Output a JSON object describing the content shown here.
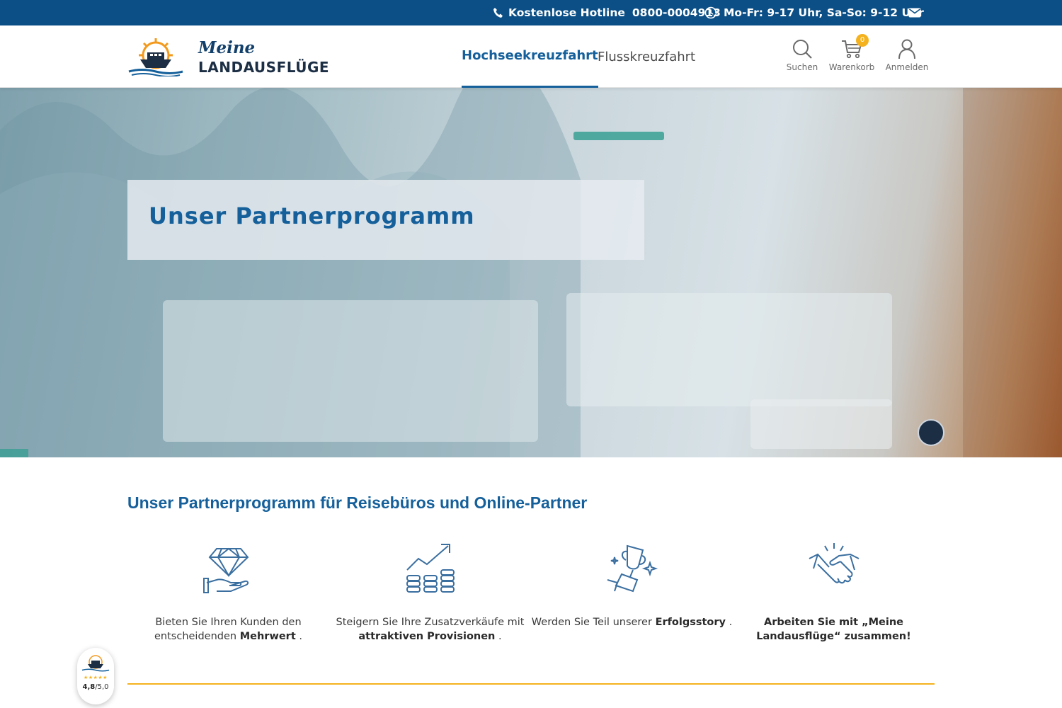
{
  "topbar": {
    "hotline_label": "Kostenlose Hotline",
    "hotline_number": "0800-0004913",
    "hours": "Mo-Fr: 9-17 Uhr, Sa-So: 9-12 Uhr"
  },
  "logo": {
    "line1": "Meine",
    "line2": "LANDAUSFLÜGE"
  },
  "nav": {
    "items": [
      {
        "label": "Hochseekreuzfahrt",
        "active": true
      },
      {
        "label": "Flusskreuzfahrt",
        "active": false
      }
    ]
  },
  "tools": {
    "search_label": "Suchen",
    "cart_label": "Warenkorb",
    "cart_count": "0",
    "login_label": "Anmelden"
  },
  "hero": {
    "title": "Unser Partnerprogramm"
  },
  "main": {
    "section_title": "Unser Partnerprogramm für Reisebüros und Online-Partner",
    "features": [
      {
        "icon": "diamond-hand-icon",
        "pre": "Bieten Sie Ihren Kunden den entscheidenden ",
        "bold": "Mehrwert",
        "post": " ."
      },
      {
        "icon": "growth-coins-icon",
        "pre": "Steigern Sie Ihre Zusatzverkäufe mit ",
        "bold": "attraktiven Provisionen",
        "post": " ."
      },
      {
        "icon": "trophy-icon",
        "pre": "Werden Sie Teil unserer ",
        "bold": "Erfolgsstory",
        "post": " ."
      },
      {
        "icon": "handshake-icon",
        "pre": "",
        "bold": "Arbeiten Sie mit „Meine Landausflüge“ zusammen!",
        "post": ""
      }
    ]
  },
  "rating": {
    "stars": "★★★★★",
    "score": "4,8",
    "scale": "/5,0"
  },
  "colors": {
    "topbar": "#0b4f86",
    "primary": "#15609b",
    "accent": "#f5b21f"
  }
}
